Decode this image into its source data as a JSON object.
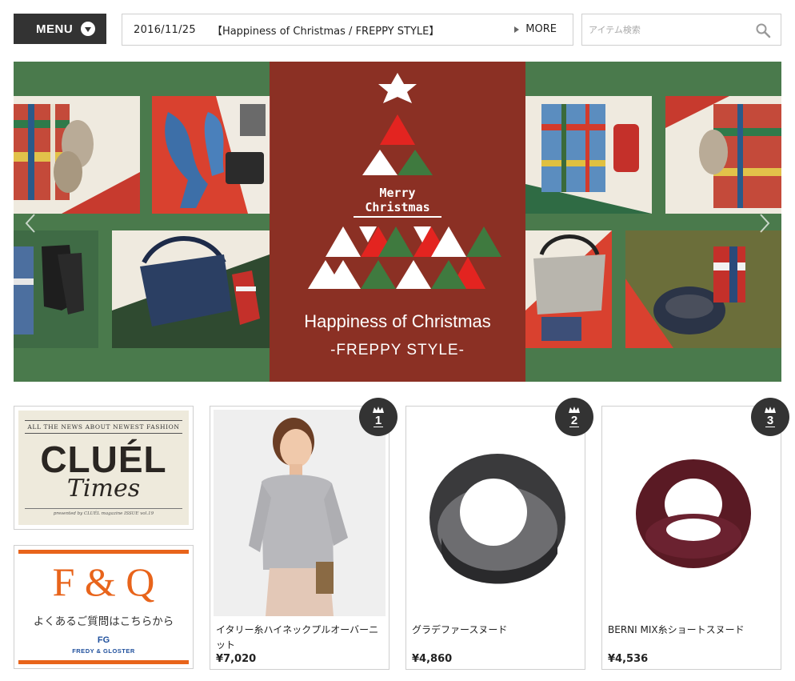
{
  "menu": {
    "label": "MENU"
  },
  "news": {
    "date": "2016/11/25",
    "title": "【Happiness of Christmas / FREPPY STYLE】",
    "more_label": "MORE"
  },
  "search": {
    "placeholder": "アイテム検索"
  },
  "hero": {
    "merry_line1": "Merry",
    "merry_line2": "Christmas",
    "title": "Happiness of Christmas",
    "subtitle": "-FREPPY STYLE-",
    "colors": {
      "green": "#4a7a4c",
      "red": "#96241e"
    }
  },
  "banners": {
    "cluel": {
      "top_text": "ALL THE NEWS ABOUT NEWEST FASHION",
      "logo": "CLUÉL",
      "logo_sub": "Times",
      "bottom_text": "presented by CLUÉL magazine ISSUE vol.19"
    },
    "fq": {
      "title": "F & Q",
      "text": "よくあるご質問はこちらから",
      "logo": "FG",
      "logo_sub": "FREDY & GLOSTER",
      "accent": "#e8641b"
    }
  },
  "ranking": [
    {
      "rank": "1",
      "name": "イタリー糸ハイネックプルオーバーニット",
      "price": "¥7,020"
    },
    {
      "rank": "2",
      "name": "グラデファースヌード",
      "price": "¥4,860"
    },
    {
      "rank": "3",
      "name": "BERNI MIX糸ショートスヌード",
      "price": "¥4,536"
    }
  ]
}
